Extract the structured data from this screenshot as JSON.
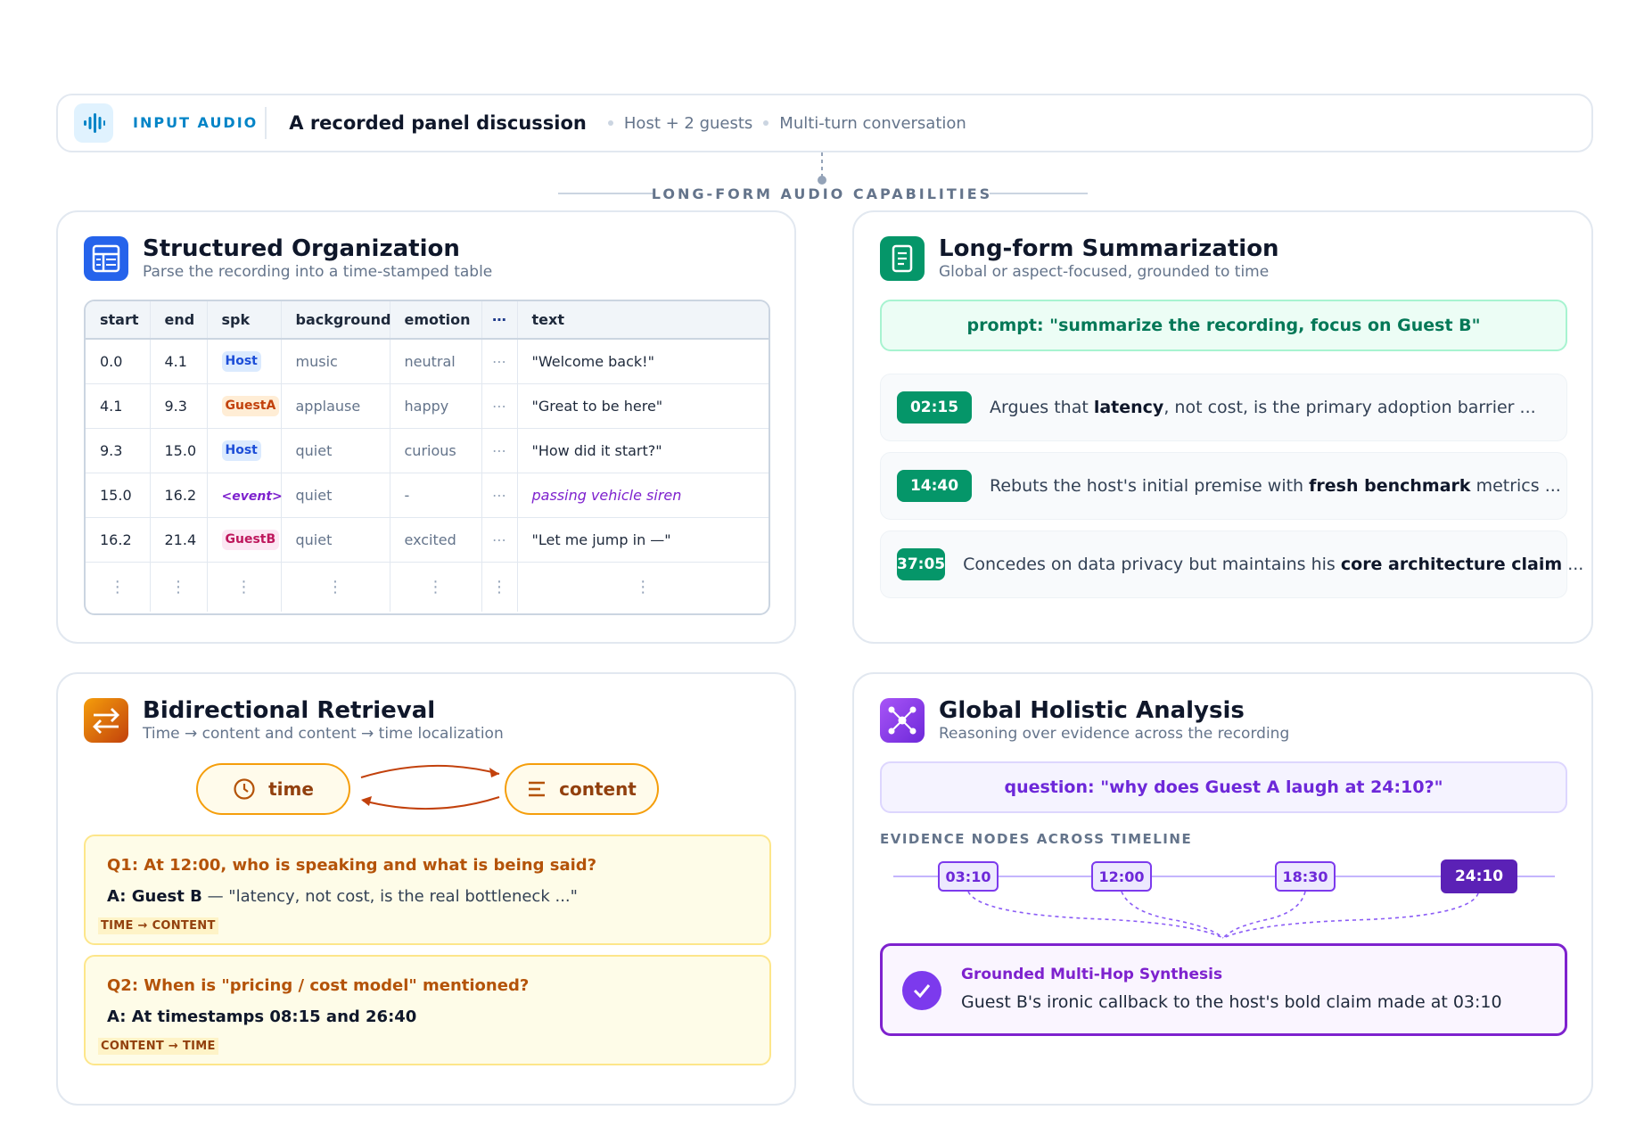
{
  "input": {
    "tag": "INPUT AUDIO",
    "title": "A recorded panel discussion",
    "meta1": "Host + 2 guests",
    "meta2": "Multi-turn conversation",
    "icon": "audio-wave-icon"
  },
  "section_label": "LONG-FORM AUDIO CAPABILITIES",
  "structured": {
    "title": "Structured Organization",
    "subtitle": "Parse the recording into a time-stamped table",
    "icon": "table-icon",
    "columns": [
      "start",
      "end",
      "spk",
      "background",
      "emotion",
      "⋯",
      "text"
    ],
    "rows": [
      {
        "start": "0.0",
        "end": "4.1",
        "spk": "Host",
        "background": "music",
        "emotion": "neutral",
        "more": "⋯",
        "text": "\"Welcome back!\""
      },
      {
        "start": "4.1",
        "end": "9.3",
        "spk": "GuestA",
        "background": "applause",
        "emotion": "happy",
        "more": "⋯",
        "text": "\"Great to be here\""
      },
      {
        "start": "9.3",
        "end": "15.0",
        "spk": "Host",
        "background": "quiet",
        "emotion": "curious",
        "more": "⋯",
        "text": "\"How did it start?\""
      },
      {
        "start": "15.0",
        "end": "16.2",
        "spk": "<event>",
        "background": "quiet",
        "emotion": "-",
        "more": "⋯",
        "text": "passing vehicle siren"
      },
      {
        "start": "16.2",
        "end": "21.4",
        "spk": "GuestB",
        "background": "quiet",
        "emotion": "excited",
        "more": "⋯",
        "text": "\"Let me jump in —\""
      }
    ],
    "continuation": "⋮"
  },
  "summarization": {
    "title": "Long-form Summarization",
    "subtitle": "Global or aspect-focused, grounded to time",
    "icon": "document-icon",
    "prompt": "prompt: \"summarize the recording, focus on Guest B\"",
    "items": [
      {
        "time": "02:15",
        "pre": "Argues that ",
        "bold": "latency",
        "post": ", not cost, is the primary adoption barrier ..."
      },
      {
        "time": "14:40",
        "pre": "Rebuts the host's initial premise with ",
        "bold": "fresh benchmark",
        "post": " metrics ..."
      },
      {
        "time": "37:05",
        "pre": "Concedes on data privacy but maintains his ",
        "bold": "core architecture claim",
        "post": " ..."
      }
    ]
  },
  "retrieval": {
    "title": "Bidirectional Retrieval",
    "subtitle": "Time → content and content → time localization",
    "icon": "swap-arrows-icon",
    "time_label": "time",
    "content_label": "content",
    "q1": {
      "question": "Q1: At 12:00, who is speaking and what is being said?",
      "answer_bold": "A: Guest B",
      "answer_rest": " — \"latency, not cost, is the real bottleneck ...\"",
      "tag": "TIME → CONTENT"
    },
    "q2": {
      "question": "Q2: When is \"pricing / cost model\" mentioned?",
      "answer_bold": "A: At timestamps 08:15 and 26:40",
      "answer_rest": "",
      "tag": "CONTENT → TIME"
    }
  },
  "holistic": {
    "title": "Global Holistic Analysis",
    "subtitle": "Reasoning over evidence across the recording",
    "icon": "network-icon",
    "question": "question: \"why does Guest A laugh at 24:10?\"",
    "evidence_label": "EVIDENCE NODES ACROSS TIMELINE",
    "nodes": [
      "03:10",
      "12:00",
      "18:30",
      "24:10"
    ],
    "synthesis_title": "Grounded Multi-Hop Synthesis",
    "synthesis_text": "Guest B's ironic callback to the host's bold claim made at 03:10"
  },
  "colors": {
    "blue": "#2563eb",
    "green": "#059669",
    "amber": "#d97706",
    "purple": "#7c3aed"
  }
}
